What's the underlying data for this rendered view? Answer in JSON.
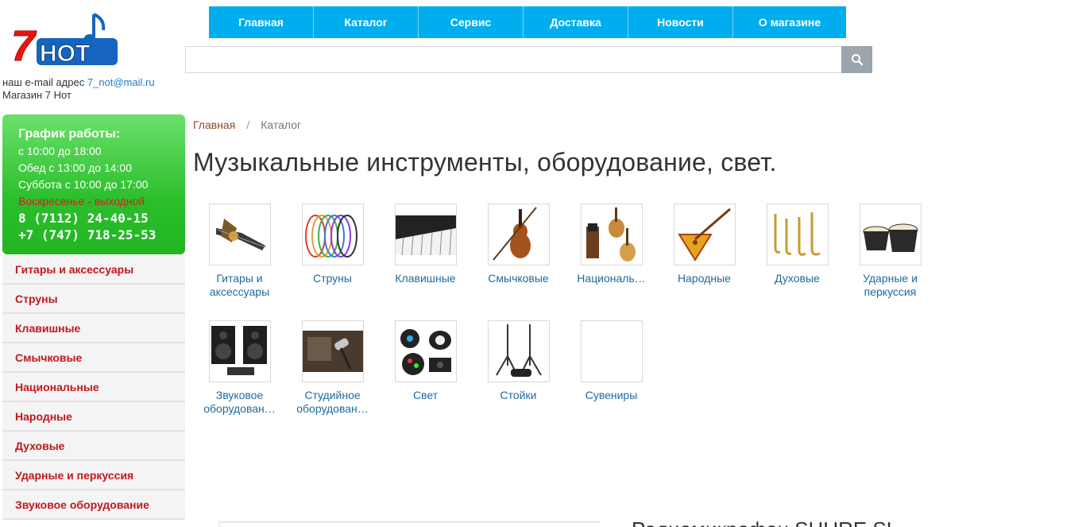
{
  "logo": {
    "text": "7НОТ"
  },
  "contact": {
    "email_prefix": "наш e-mail адрес",
    "email": "7_not@mail.ru",
    "store_name": "Магазин 7 Нот"
  },
  "nav": [
    {
      "label": "Главная"
    },
    {
      "label": "Каталог"
    },
    {
      "label": "Сервис"
    },
    {
      "label": "Доставка"
    },
    {
      "label": "Новости"
    },
    {
      "label": "О магазине"
    }
  ],
  "search": {
    "placeholder": "",
    "value": ""
  },
  "schedule": {
    "title": "График работы:",
    "hours": "с 10:00 до 18:00",
    "lunch": "Обед с 13:00 до 14:00",
    "saturday": "Суббота с 10:00 до 17:00",
    "sunday": "Воскресенье - выходной",
    "phone1": "8 (7112) 24-40-15",
    "phone2": "+7 (747) 718-25-53"
  },
  "sidebar": {
    "items": [
      {
        "label": "Гитары и аксессуары"
      },
      {
        "label": "Струны"
      },
      {
        "label": "Клавишные"
      },
      {
        "label": "Смычковые"
      },
      {
        "label": "Национальные"
      },
      {
        "label": "Народные"
      },
      {
        "label": "Духовые"
      },
      {
        "label": "Ударные и перкуссия"
      },
      {
        "label": "Звуковое оборудование"
      }
    ]
  },
  "breadcrumb": {
    "home": "Главная",
    "separator": "/",
    "current": "Каталог"
  },
  "page_title": "Музыкальные инструменты, оборудование, свет.",
  "categories": [
    {
      "label": "Гитары и аксессуары",
      "icon": "guitar-icon"
    },
    {
      "label": "Струны",
      "icon": "strings-icon"
    },
    {
      "label": "Клавишные",
      "icon": "keyboard-icon"
    },
    {
      "label": "Смычковые",
      "icon": "violin-icon"
    },
    {
      "label": "Националь…",
      "icon": "dombra-icon"
    },
    {
      "label": "Народные",
      "icon": "balalaika-icon"
    },
    {
      "label": "Духовые",
      "icon": "saxophone-icon"
    },
    {
      "label": "Ударные и перкуссия",
      "icon": "bongo-icon"
    },
    {
      "label": "Звуковое оборудован…",
      "icon": "speaker-icon"
    },
    {
      "label": "Студийное оборудован…",
      "icon": "microphone-icon"
    },
    {
      "label": "Свет",
      "icon": "light-icon"
    },
    {
      "label": "Стойки",
      "icon": "stand-icon"
    },
    {
      "label": "Сувениры",
      "icon": "souvenir-icon"
    }
  ],
  "bottom": {
    "heading": "Радиомикрофон SHURE SL"
  },
  "colors": {
    "nav": "#00aeef",
    "schedule_green": "#2cbf2c",
    "menu_red": "#c4161c",
    "link_blue": "#1e6a9e"
  }
}
